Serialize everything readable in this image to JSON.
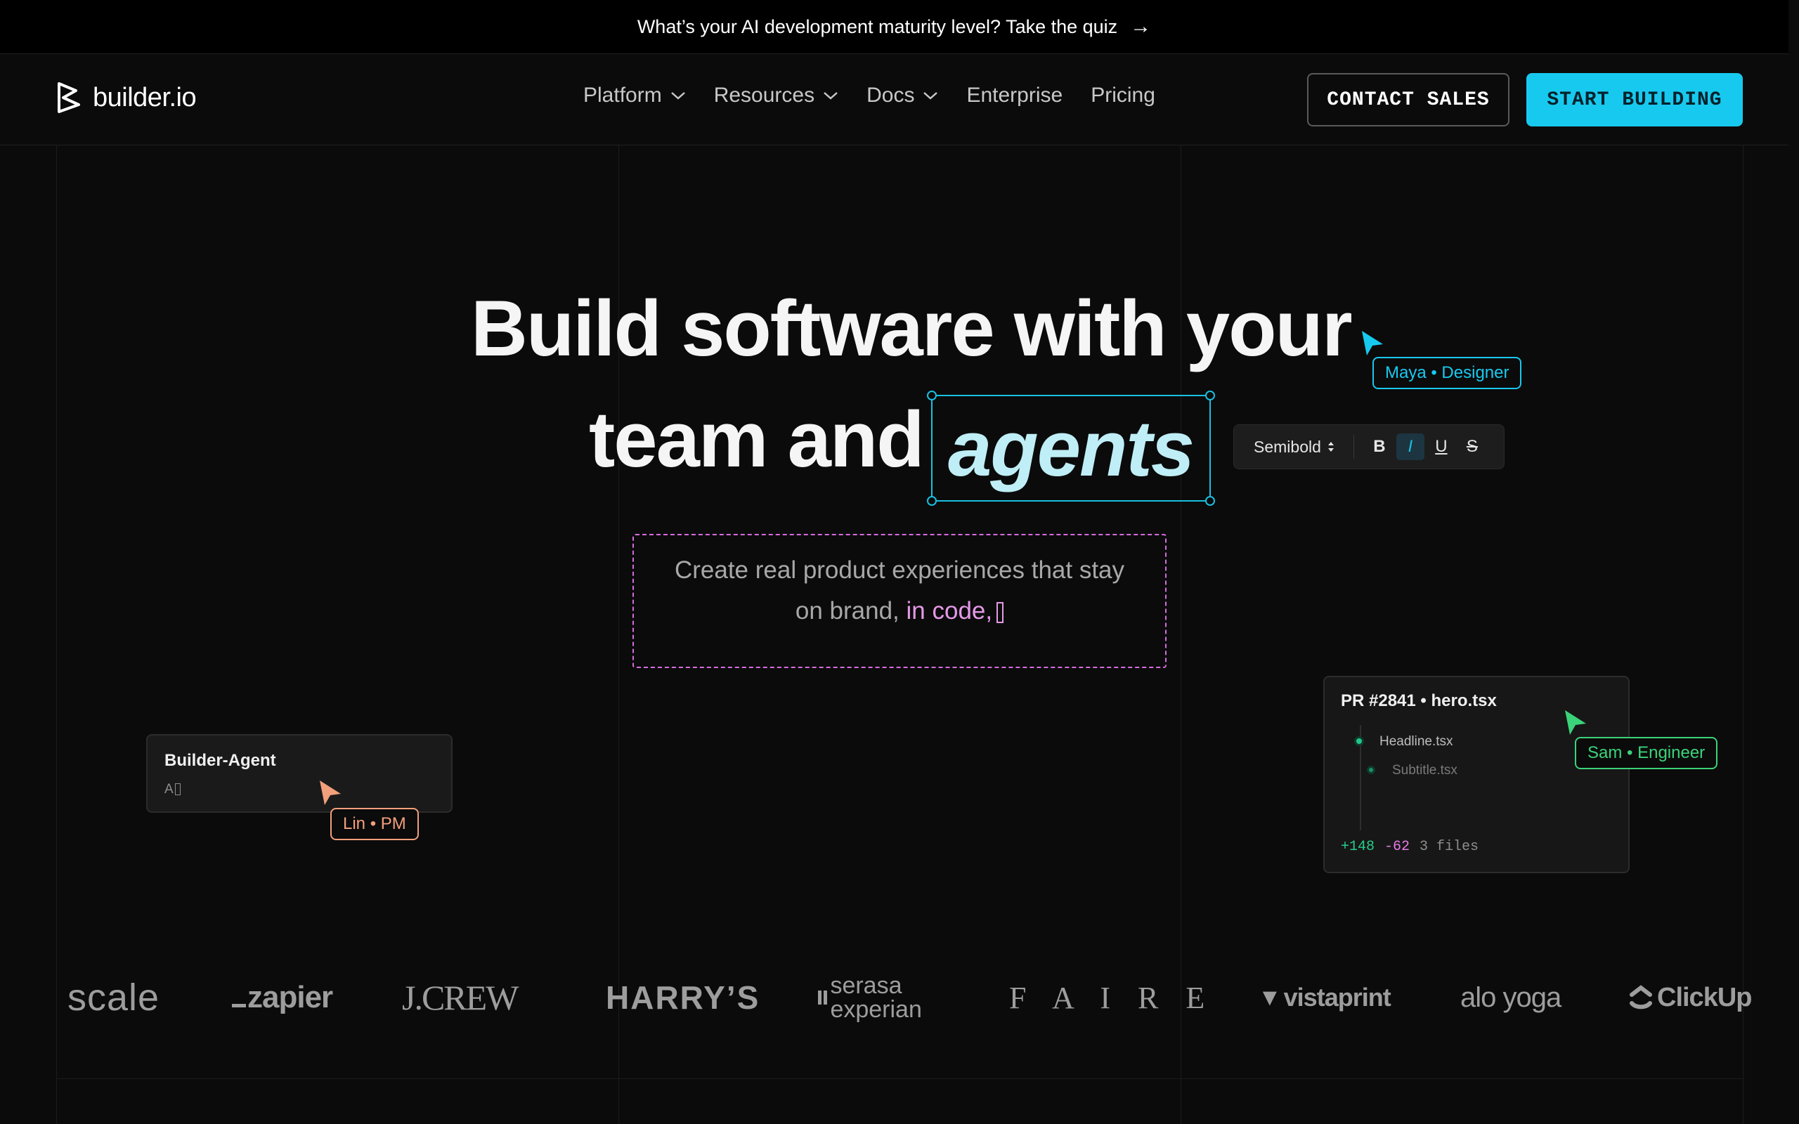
{
  "announcement": {
    "text": "What’s your AI development maturity level? Take the quiz",
    "arrow_icon": "arrow-right-icon"
  },
  "nav": {
    "logo_text": "builder.io",
    "items": [
      {
        "label": "Platform",
        "has_dropdown": true
      },
      {
        "label": "Resources",
        "has_dropdown": true
      },
      {
        "label": "Docs",
        "has_dropdown": true
      },
      {
        "label": "Enterprise",
        "has_dropdown": false
      },
      {
        "label": "Pricing",
        "has_dropdown": false
      }
    ],
    "contact_label": "CONTACT SALES",
    "start_label": "START BUILDING"
  },
  "hero": {
    "line1": "Build software with your",
    "line2_prefix": "team and",
    "highlight_word": "agents",
    "subtitle_line1": "Create real product experiences that stay",
    "subtitle_line2_prefix": "on brand,",
    "subtitle_line2_highlight": "in code,"
  },
  "toolbar": {
    "font_weight": "Semibold",
    "bold": "B",
    "italic": "I",
    "underline": "U",
    "strike": "S"
  },
  "collaborators": {
    "designer": "Maya • Designer",
    "pm": "Lin • PM",
    "engineer": "Sam • Engineer"
  },
  "agent_card": {
    "title": "Builder-Agent",
    "input": "A"
  },
  "pr_card": {
    "title": "PR #2841 • hero.tsx",
    "files": [
      "Headline.tsx",
      "Subtitle.tsx"
    ],
    "additions": "+148",
    "deletions": "-62",
    "files_count": "3 files"
  },
  "customers": [
    "scale",
    "zapier",
    "J.CREW",
    "HARRY’S",
    "serasa experian",
    "F A I R E",
    "vistaprint",
    "alo yoga",
    "ClickUp"
  ],
  "colors": {
    "accent_cyan": "#18c9ef",
    "accent_pink": "#e59ae8",
    "accent_orange": "#f2a07b",
    "accent_green": "#3bd37a",
    "background": "#0b0b0b"
  }
}
